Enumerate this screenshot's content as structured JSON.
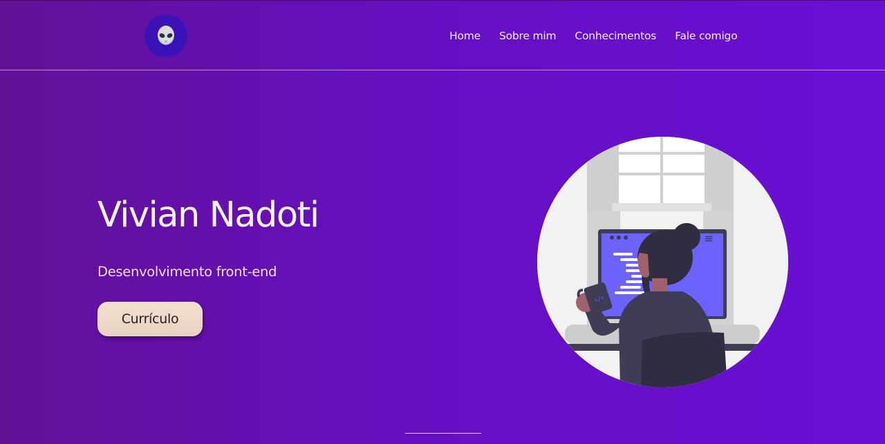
{
  "header": {
    "logo_icon": "alien-face-icon",
    "nav": [
      {
        "label": "Home"
      },
      {
        "label": "Sobre mim"
      },
      {
        "label": "Conhecimentos"
      },
      {
        "label": "Fale comigo"
      }
    ]
  },
  "hero": {
    "title": "Vivian Nadoti",
    "subtitle": "Desenvolvimento front-end",
    "button_label": "Currículo",
    "illustration": "developer-at-computer-illustration"
  },
  "colors": {
    "background_start": "#611296",
    "background_end": "#6a0fd6",
    "logo_bg": "#3b12b8",
    "button_bg": "#f0dccb",
    "screen": "#6c63ff"
  }
}
